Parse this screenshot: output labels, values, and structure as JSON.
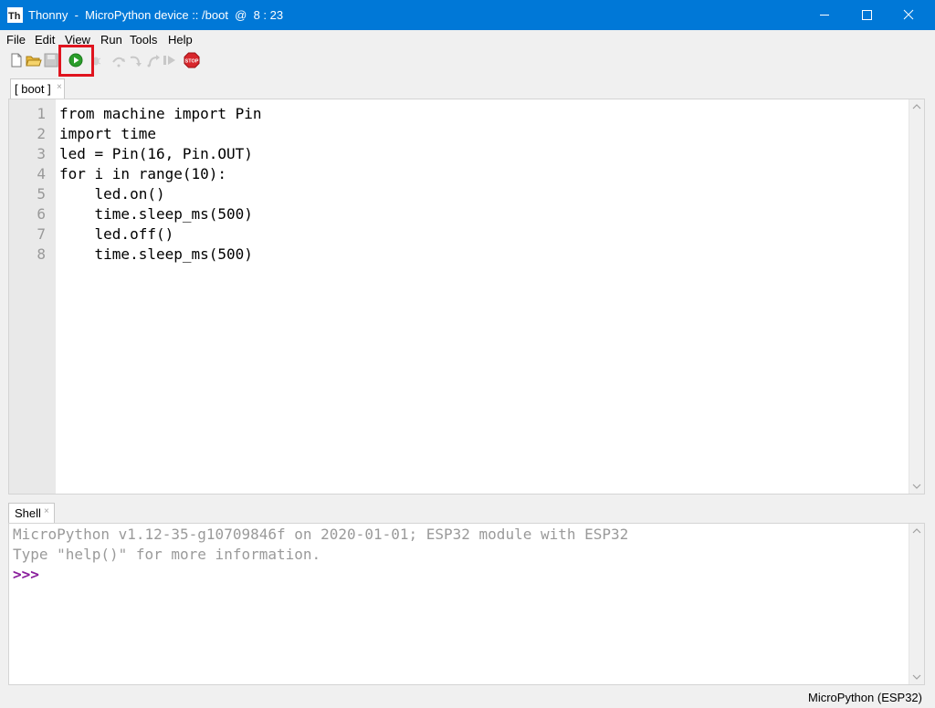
{
  "window": {
    "title": "Thonny  -  MicroPython device :: /boot  @  8 : 23",
    "icon": "thonny-logo-icon"
  },
  "menu": [
    "File",
    "Edit",
    "View",
    "Run",
    "Tools",
    "Help"
  ],
  "toolbar": {
    "buttons": [
      "new-file",
      "open-file",
      "save-file",
      "run-current-script",
      "debug",
      "step-over",
      "step-into",
      "step-out",
      "resume",
      "stop"
    ],
    "stop_label": "STOP",
    "highlight_color": "#e0141e"
  },
  "editor": {
    "tab": {
      "label": "[ boot ]",
      "close": "×"
    },
    "line_numbers": [
      "1",
      "2",
      "3",
      "4",
      "5",
      "6",
      "7",
      "8"
    ],
    "code_lines": [
      "from machine import Pin",
      "import time",
      "led = Pin(16, Pin.OUT)",
      "for i in range(10):",
      "    led.on()",
      "    time.sleep_ms(500)",
      "    led.off()",
      "    time.sleep_ms(500)"
    ]
  },
  "shell": {
    "tab": {
      "label": "Shell",
      "close": "×"
    },
    "lines": [
      "MicroPython v1.12-35-g10709846f on 2020-01-01; ESP32 module with ESP32",
      "Type \"help()\" for more information."
    ],
    "prompt": ">>>"
  },
  "status": {
    "interpreter": "MicroPython (ESP32)"
  },
  "colors": {
    "titlebar": "#0078d7",
    "prompt": "#8a1e9c",
    "run_green": "#2a9d2a"
  }
}
